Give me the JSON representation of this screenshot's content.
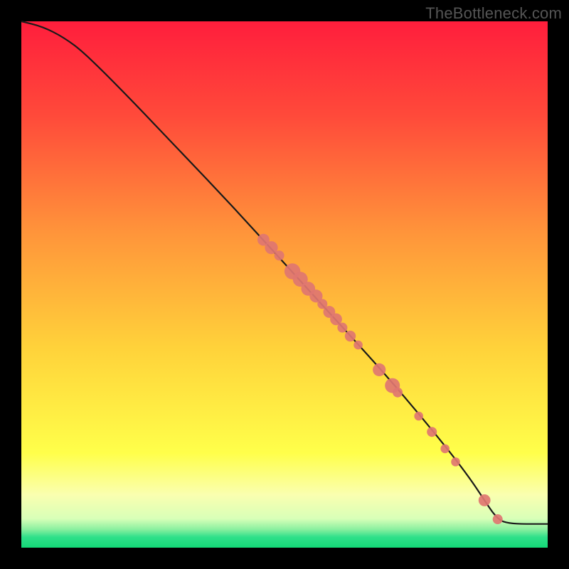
{
  "watermark": "TheBottleneck.com",
  "chart_data": {
    "type": "line",
    "title": "",
    "xlabel": "",
    "ylabel": "",
    "xlim": [
      0,
      100
    ],
    "ylim": [
      0,
      100
    ],
    "gradient_stops": [
      {
        "pct": 0,
        "color": "#ff1e3c"
      },
      {
        "pct": 18,
        "color": "#ff4a3a"
      },
      {
        "pct": 40,
        "color": "#ff943a"
      },
      {
        "pct": 62,
        "color": "#ffd23a"
      },
      {
        "pct": 82,
        "color": "#ffff4a"
      },
      {
        "pct": 90,
        "color": "#faffb0"
      },
      {
        "pct": 94.5,
        "color": "#d8ffb8"
      },
      {
        "pct": 96.5,
        "color": "#8bf0a0"
      },
      {
        "pct": 98,
        "color": "#2fe08a"
      },
      {
        "pct": 100,
        "color": "#14d977"
      }
    ],
    "series": [
      {
        "name": "bottleneck-curve",
        "type": "line",
        "x": [
          0,
          4,
          8,
          12,
          20,
          30,
          40,
          50,
          60,
          70,
          80,
          85,
          88,
          90,
          92,
          100
        ],
        "y": [
          100,
          99,
          97,
          94,
          86,
          75.5,
          65,
          54,
          43,
          32,
          20,
          13.5,
          9,
          6,
          4.5,
          4.5
        ]
      }
    ],
    "points": [
      {
        "x": 46.0,
        "y": 58.5,
        "r": 1.2
      },
      {
        "x": 47.5,
        "y": 57.0,
        "r": 1.3
      },
      {
        "x": 49.0,
        "y": 55.5,
        "r": 1.0
      },
      {
        "x": 51.5,
        "y": 52.5,
        "r": 1.6
      },
      {
        "x": 53.0,
        "y": 51.0,
        "r": 1.5
      },
      {
        "x": 54.5,
        "y": 49.2,
        "r": 1.4
      },
      {
        "x": 56.0,
        "y": 47.8,
        "r": 1.3
      },
      {
        "x": 57.2,
        "y": 46.3,
        "r": 1.0
      },
      {
        "x": 58.5,
        "y": 44.8,
        "r": 1.2
      },
      {
        "x": 59.8,
        "y": 43.4,
        "r": 1.2
      },
      {
        "x": 61.0,
        "y": 41.8,
        "r": 1.0
      },
      {
        "x": 62.5,
        "y": 40.2,
        "r": 1.1
      },
      {
        "x": 64.0,
        "y": 38.5,
        "r": 0.9
      },
      {
        "x": 68.0,
        "y": 33.8,
        "r": 1.3
      },
      {
        "x": 70.5,
        "y": 30.8,
        "r": 1.5
      },
      {
        "x": 71.5,
        "y": 29.5,
        "r": 1.0
      },
      {
        "x": 75.5,
        "y": 25.0,
        "r": 0.9
      },
      {
        "x": 78.0,
        "y": 22.0,
        "r": 1.0
      },
      {
        "x": 80.5,
        "y": 18.8,
        "r": 0.9
      },
      {
        "x": 82.5,
        "y": 16.3,
        "r": 0.9
      },
      {
        "x": 88.0,
        "y": 9.0,
        "r": 1.2
      },
      {
        "x": 90.5,
        "y": 5.4,
        "r": 1.0
      }
    ],
    "point_color": "#e07671",
    "line_color": "#1a1a1a"
  }
}
